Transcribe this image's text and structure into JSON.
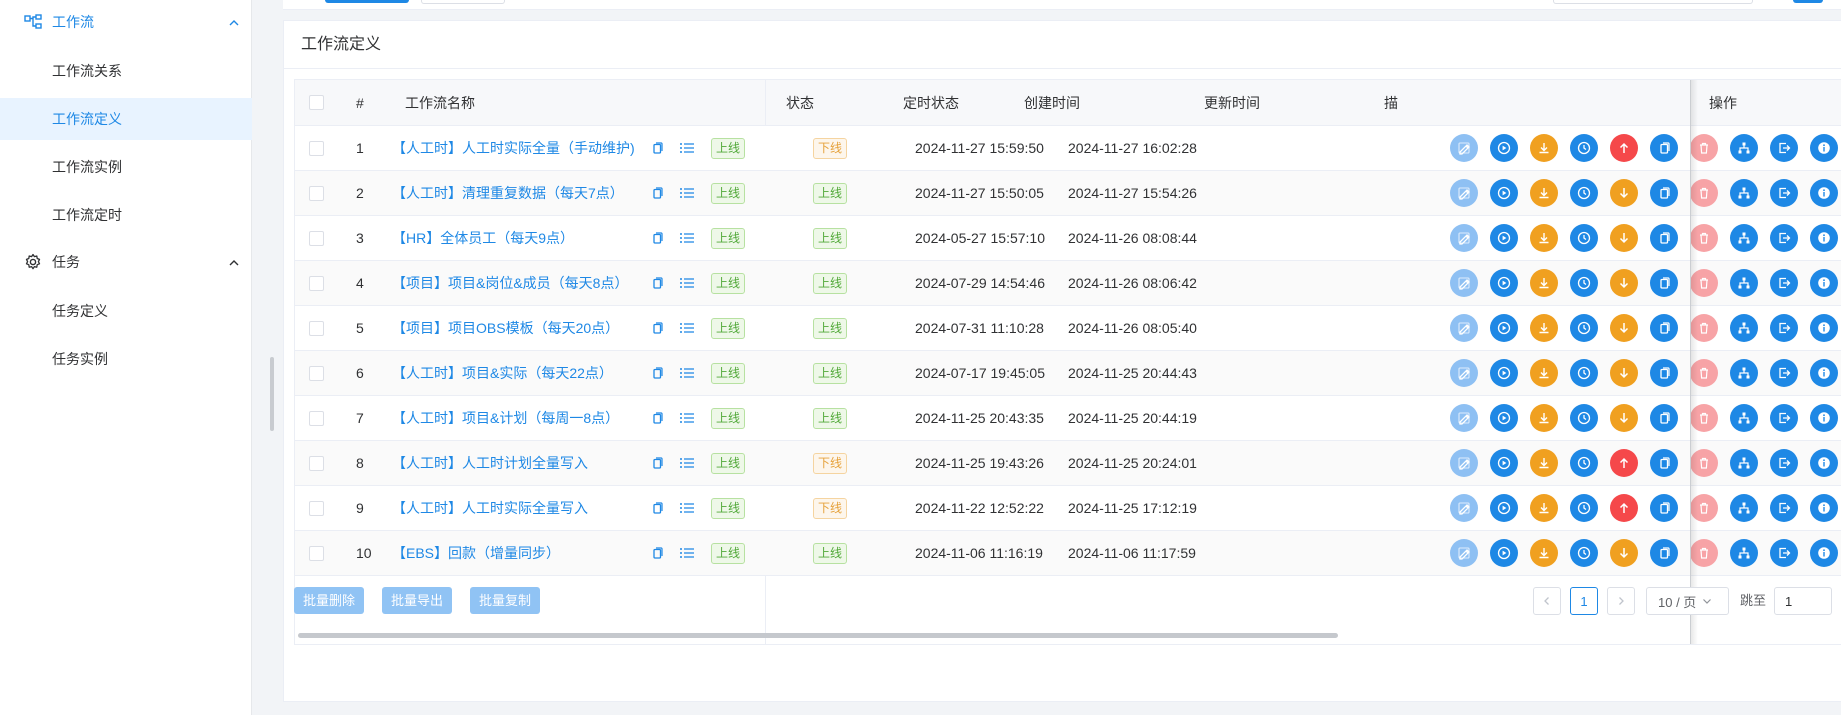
{
  "sidebar": {
    "groups": [
      {
        "label": "工作流",
        "icon": "workflow-icon",
        "expanded": true,
        "active": true
      },
      {
        "label": "任务",
        "icon": "gear-icon",
        "expanded": true,
        "active": false
      }
    ],
    "workflow_items": [
      "工作流关系",
      "工作流定义",
      "工作流实例",
      "工作流定时"
    ],
    "task_items": [
      "任务定义",
      "任务实例"
    ],
    "active_item": "工作流定义"
  },
  "card": {
    "title": "工作流定义"
  },
  "table": {
    "headers": {
      "index": "#",
      "name": "工作流名称",
      "status": "状态",
      "schedule_status": "定时状态",
      "created": "创建时间",
      "updated": "更新时间",
      "desc": "描",
      "actions": "操作"
    },
    "rows": [
      {
        "index": "1",
        "name": "【人工时】人工时实际全量（手动维护)",
        "status": "上线",
        "schedule": "下线",
        "created": "2024-11-27 15:59:50",
        "updated": "2024-11-27 16:02:28"
      },
      {
        "index": "2",
        "name": "【人工时】清理重复数据（每天7点）",
        "status": "上线",
        "schedule": "上线",
        "created": "2024-11-27 15:50:05",
        "updated": "2024-11-27 15:54:26"
      },
      {
        "index": "3",
        "name": "【HR】全体员工（每天9点）",
        "status": "上线",
        "schedule": "上线",
        "created": "2024-05-27 15:57:10",
        "updated": "2024-11-26 08:08:44"
      },
      {
        "index": "4",
        "name": "【项目】项目&岗位&成员（每天8点）",
        "status": "上线",
        "schedule": "上线",
        "created": "2024-07-29 14:54:46",
        "updated": "2024-11-26 08:06:42"
      },
      {
        "index": "5",
        "name": "【项目】项目OBS模板（每天20点）",
        "status": "上线",
        "schedule": "上线",
        "created": "2024-07-31 11:10:28",
        "updated": "2024-11-26 08:05:40"
      },
      {
        "index": "6",
        "name": "【人工时】项目&实际（每天22点）",
        "status": "上线",
        "schedule": "上线",
        "created": "2024-07-17 19:45:05",
        "updated": "2024-11-25 20:44:43"
      },
      {
        "index": "7",
        "name": "【人工时】项目&计划（每周一8点）",
        "status": "上线",
        "schedule": "上线",
        "created": "2024-11-25 20:43:35",
        "updated": "2024-11-25 20:44:19"
      },
      {
        "index": "8",
        "name": "【人工时】人工时计划全量写入",
        "status": "上线",
        "schedule": "下线",
        "created": "2024-11-25 19:43:26",
        "updated": "2024-11-25 20:24:01"
      },
      {
        "index": "9",
        "name": "【人工时】人工时实际全量写入",
        "status": "上线",
        "schedule": "下线",
        "created": "2024-11-22 12:52:22",
        "updated": "2024-11-25 17:12:19"
      },
      {
        "index": "10",
        "name": "【EBS】回款（增量同步）",
        "status": "上线",
        "schedule": "上线",
        "created": "2024-11-06 11:16:19",
        "updated": "2024-11-06 11:17:59"
      }
    ]
  },
  "footer": {
    "bulk_delete": "批量删除",
    "bulk_export": "批量导出",
    "bulk_copy": "批量复制",
    "current_page": "1",
    "page_size": "10 / 页",
    "jump_label": "跳至",
    "jump_value": "1"
  },
  "colors": {
    "primary": "#1e88e5",
    "primary_light": "#8ec0f3",
    "orange": "#f0a020",
    "red": "#f5484a",
    "pink": "#f7a3a6",
    "online_green": "#52a93a",
    "offline_orange": "#e6a23c"
  }
}
